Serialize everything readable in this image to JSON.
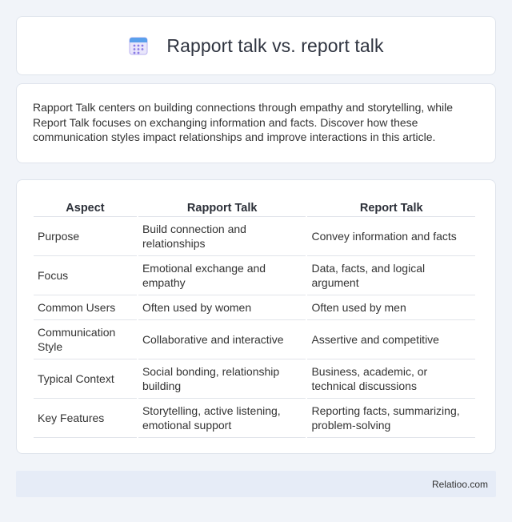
{
  "header": {
    "title": "Rapport talk vs. report talk",
    "icon": "calendar-icon"
  },
  "intro": {
    "text": "Rapport Talk centers on building connections through empathy and storytelling, while Report Talk focuses on exchanging information and facts. Discover how these communication styles impact relationships and improve interactions in this article."
  },
  "table": {
    "headers": [
      "Aspect",
      "Rapport Talk",
      "Report Talk"
    ],
    "rows": [
      [
        "Purpose",
        "Build connection and relationships",
        "Convey information and facts"
      ],
      [
        "Focus",
        "Emotional exchange and empathy",
        "Data, facts, and logical argument"
      ],
      [
        "Common Users",
        "Often used by women",
        "Often used by men"
      ],
      [
        "Communication Style",
        "Collaborative and interactive",
        "Assertive and competitive"
      ],
      [
        "Typical Context",
        "Social bonding, relationship building",
        "Business, academic, or technical discussions"
      ],
      [
        "Key Features",
        "Storytelling, active listening, emotional support",
        "Reporting facts, summarizing, problem-solving"
      ]
    ]
  },
  "footer": {
    "brand": "Relatioo.com"
  },
  "colors": {
    "background": "#f1f4f9",
    "card": "#ffffff",
    "footer": "#e6ecf7",
    "icon_accent": "#7b6be6"
  }
}
